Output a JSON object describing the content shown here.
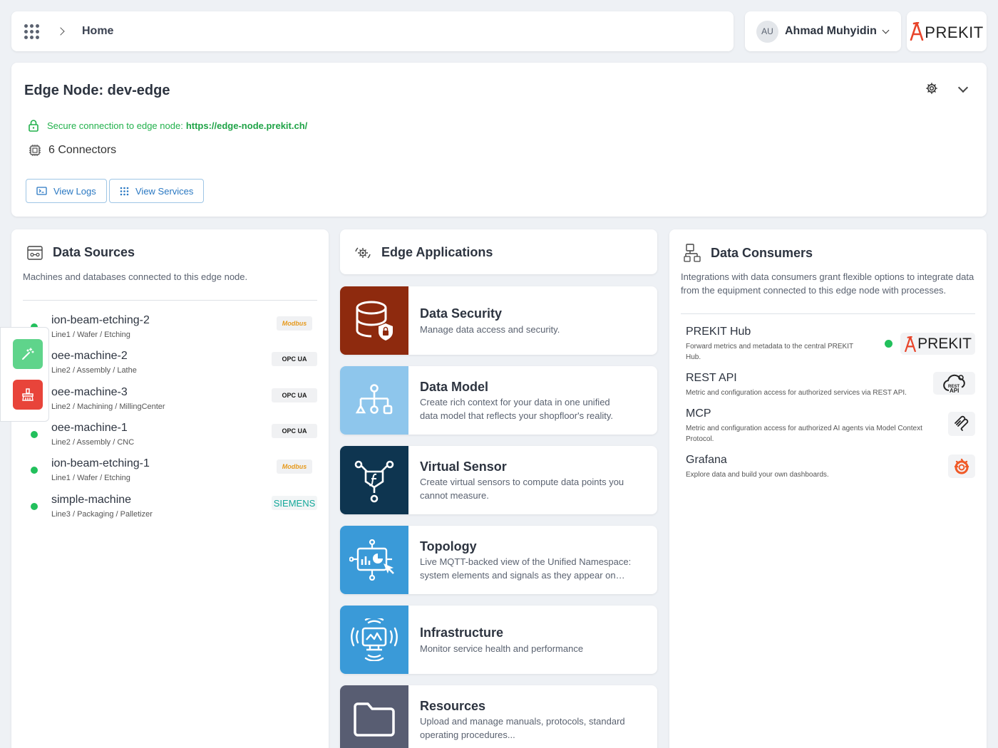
{
  "topbar": {
    "breadcrumb": "Home"
  },
  "user": {
    "initials": "AU",
    "name": "Ahmad Muhyidin"
  },
  "brand": {
    "name": "PREKIT",
    "accent": "#e8442a"
  },
  "edge_node": {
    "title": "Edge Node: dev-edge",
    "secure_label": "Secure connection to edge node:",
    "secure_url": "https://edge-node.prekit.ch/",
    "connectors": "6 Connectors",
    "view_logs": "View Logs",
    "view_services": "View Services"
  },
  "data_sources": {
    "title": "Data Sources",
    "description": "Machines and databases connected to this edge node.",
    "items": [
      {
        "name": "ion-beam-etching-2",
        "path": "Line1 / Wafer / Etching",
        "protocol": "Modbus",
        "status": "online"
      },
      {
        "name": "oee-machine-2",
        "path": "Line2 / Assembly / Lathe",
        "protocol": "OPC UA",
        "status": "online"
      },
      {
        "name": "oee-machine-3",
        "path": "Line2 / Machining / MillingCenter",
        "protocol": "OPC UA",
        "status": "online"
      },
      {
        "name": "oee-machine-1",
        "path": "Line2 / Assembly / CNC",
        "protocol": "OPC UA",
        "status": "online"
      },
      {
        "name": "ion-beam-etching-1",
        "path": "Line1 / Wafer / Etching",
        "protocol": "Modbus",
        "status": "online"
      },
      {
        "name": "simple-machine",
        "path": "Line3 / Packaging / Palletizer",
        "protocol": "SIEMENS",
        "status": "online"
      }
    ],
    "protocol_labels": {
      "modbus": "Modbus",
      "opcua": "OPC UA",
      "siemens": "SIEMENS"
    }
  },
  "edge_applications": {
    "title": "Edge Applications",
    "apps": [
      {
        "title": "Data Security",
        "desc": "Manage data access and security.",
        "color": "#8e2a0e"
      },
      {
        "title": "Data Model",
        "desc": "Create rich context for your data in one unified data model that reflects your shopfloor's reality.",
        "desc_line1": "Create rich context for your data in one unified",
        "desc_line2": "data model that reflects your shopfloor's reality.",
        "color": "#8ec6ec"
      },
      {
        "title": "Virtual Sensor",
        "desc_line1": "Create virtual sensors to compute data points you",
        "desc_line2": "cannot measure.",
        "color": "#0e3550"
      },
      {
        "title": "Topology",
        "desc_line1": "Live MQTT-backed view of the Unified Namespace:",
        "desc_line2": "system elements and signals as they appear on…",
        "color": "#3a9ad8"
      },
      {
        "title": "Infrastructure",
        "desc": "Monitor service health and performance",
        "color": "#3a9ad8"
      },
      {
        "title": "Resources",
        "desc_line1": "Upload and manage manuals, protocols, standard",
        "desc_line2": "operating procedures...",
        "color": "#585d72"
      }
    ]
  },
  "data_consumers": {
    "title": "Data Consumers",
    "desc_line1": "Integrations with data consumers grant flexible options to integrate data",
    "desc_line2": "from the equipment connected to this edge node with processes.",
    "items": [
      {
        "name": "PREKIT Hub",
        "desc_line1": "Forward metrics and metadata to the central PREKIT",
        "desc_line2": "Hub.",
        "status": "online"
      },
      {
        "name": "REST API",
        "desc_line1": "Metric and configuration access for authorized services via REST API.",
        "logo_text": "REST API"
      },
      {
        "name": "MCP",
        "desc_line1": "Metric and configuration access for authorized AI agents via Model Context",
        "desc_line2": "Protocol."
      },
      {
        "name": "Grafana",
        "desc_line1": "Explore data and build your own dashboards."
      }
    ]
  },
  "icons": [
    "apps-grid-icon",
    "chevron-right-icon",
    "chevron-down-icon",
    "gear-icon",
    "lock-icon",
    "chip-icon",
    "terminal-icon",
    "grid-icon",
    "magic-wand-icon",
    "broom-icon",
    "database-lock-icon",
    "hierarchy-icon",
    "function-icon",
    "chart-cursor-icon",
    "monitor-wave-icon",
    "folder-icon",
    "source-icon",
    "cog-cycle-icon",
    "consumer-icon",
    "grafana-icon",
    "mcp-icon",
    "rest-api-icon"
  ]
}
